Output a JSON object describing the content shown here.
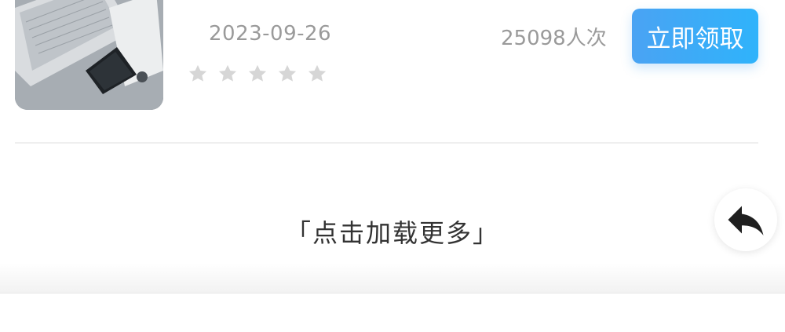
{
  "item": {
    "date": "2023-09-26",
    "views": "25098人次",
    "claim_label": "立即领取",
    "rating_stars": 5,
    "rating_filled": 0
  },
  "footer": {
    "load_more_label": "「点击加载更多」"
  },
  "icons": {
    "back": "reply-arrow-icon",
    "star": "star-icon"
  },
  "colors": {
    "accent_start": "#4aa3f3",
    "accent_end": "#2fb3fb",
    "muted_text": "#9a9a9a",
    "star_gray": "#d6d6d6"
  }
}
